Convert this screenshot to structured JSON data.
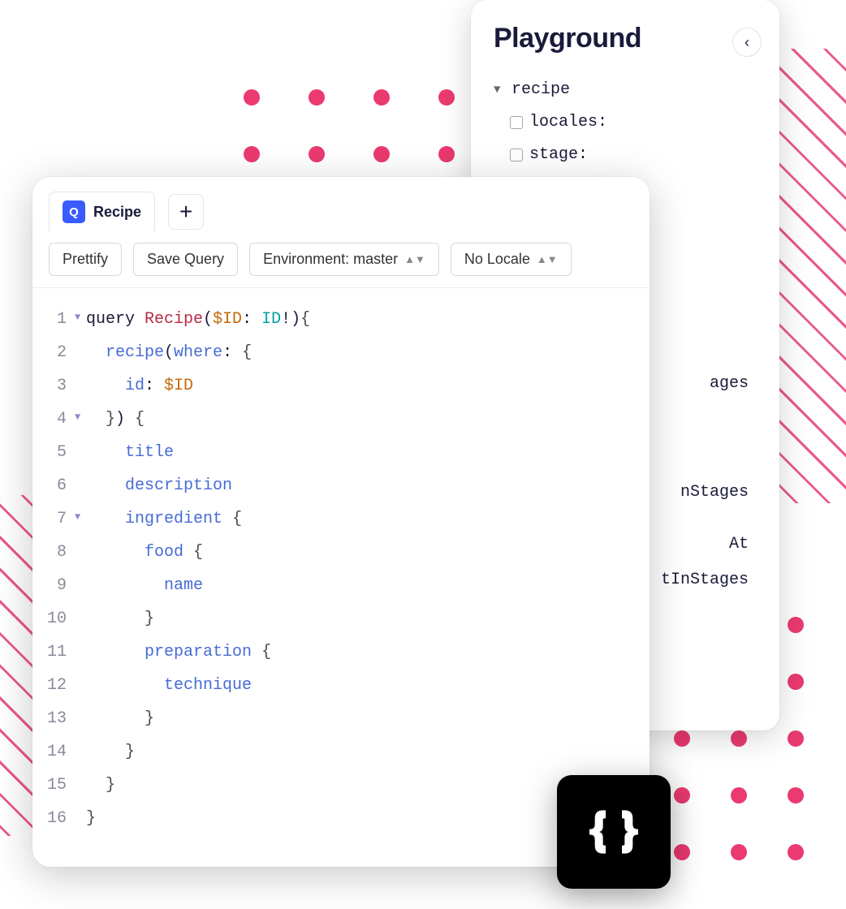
{
  "playground": {
    "title": "Playground",
    "tree": {
      "root": "recipe",
      "args": [
        {
          "label": "locales:"
        },
        {
          "label": "stage:"
        }
      ]
    },
    "explorer_fragments": [
      "ages",
      "nStages",
      "At",
      "tInStages"
    ]
  },
  "editor": {
    "tab": {
      "badge": "Q",
      "label": "Recipe"
    },
    "toolbar": {
      "prettify": "Prettify",
      "save": "Save Query",
      "environment": "Environment: master",
      "locale": "No Locale"
    },
    "code": [
      {
        "n": 1,
        "fold": true,
        "tokens": [
          [
            "kw",
            "query "
          ],
          [
            "def",
            "Recipe"
          ],
          [
            "p",
            "("
          ],
          [
            "var",
            "$ID"
          ],
          [
            "p",
            ": "
          ],
          [
            "type",
            "ID"
          ],
          [
            "p",
            "!"
          ],
          [
            "p",
            ")"
          ],
          [
            "brace",
            "{"
          ]
        ]
      },
      {
        "n": 2,
        "fold": false,
        "tokens": [
          [
            "p",
            "  "
          ],
          [
            "field",
            "recipe"
          ],
          [
            "p",
            "("
          ],
          [
            "attr",
            "where"
          ],
          [
            "p",
            ": "
          ],
          [
            "brace",
            "{"
          ]
        ]
      },
      {
        "n": 3,
        "fold": false,
        "tokens": [
          [
            "p",
            "    "
          ],
          [
            "attr",
            "id"
          ],
          [
            "p",
            ": "
          ],
          [
            "var",
            "$ID"
          ]
        ]
      },
      {
        "n": 4,
        "fold": true,
        "tokens": [
          [
            "p",
            "  "
          ],
          [
            "brace",
            "}"
          ],
          [
            "p",
            ") "
          ],
          [
            "brace",
            "{"
          ]
        ]
      },
      {
        "n": 5,
        "fold": false,
        "tokens": [
          [
            "p",
            "    "
          ],
          [
            "field",
            "title"
          ]
        ]
      },
      {
        "n": 6,
        "fold": false,
        "tokens": [
          [
            "p",
            "    "
          ],
          [
            "field",
            "description"
          ]
        ]
      },
      {
        "n": 7,
        "fold": true,
        "tokens": [
          [
            "p",
            "    "
          ],
          [
            "field",
            "ingredient"
          ],
          [
            "p",
            " "
          ],
          [
            "brace",
            "{"
          ]
        ]
      },
      {
        "n": 8,
        "fold": false,
        "tokens": [
          [
            "p",
            "      "
          ],
          [
            "field",
            "food"
          ],
          [
            "p",
            " "
          ],
          [
            "brace",
            "{"
          ]
        ]
      },
      {
        "n": 9,
        "fold": false,
        "tokens": [
          [
            "p",
            "        "
          ],
          [
            "field",
            "name"
          ]
        ]
      },
      {
        "n": 10,
        "fold": false,
        "tokens": [
          [
            "p",
            "      "
          ],
          [
            "brace",
            "}"
          ]
        ]
      },
      {
        "n": 11,
        "fold": false,
        "tokens": [
          [
            "p",
            "      "
          ],
          [
            "field",
            "preparation"
          ],
          [
            "p",
            " "
          ],
          [
            "brace",
            "{"
          ]
        ]
      },
      {
        "n": 12,
        "fold": false,
        "tokens": [
          [
            "p",
            "        "
          ],
          [
            "field",
            "technique"
          ]
        ]
      },
      {
        "n": 13,
        "fold": false,
        "tokens": [
          [
            "p",
            "      "
          ],
          [
            "brace",
            "}"
          ]
        ]
      },
      {
        "n": 14,
        "fold": false,
        "tokens": [
          [
            "p",
            "    "
          ],
          [
            "brace",
            "}"
          ]
        ]
      },
      {
        "n": 15,
        "fold": false,
        "tokens": [
          [
            "p",
            "  "
          ],
          [
            "brace",
            "}"
          ]
        ]
      },
      {
        "n": 16,
        "fold": false,
        "tokens": [
          [
            "brace",
            "}"
          ]
        ]
      }
    ]
  }
}
